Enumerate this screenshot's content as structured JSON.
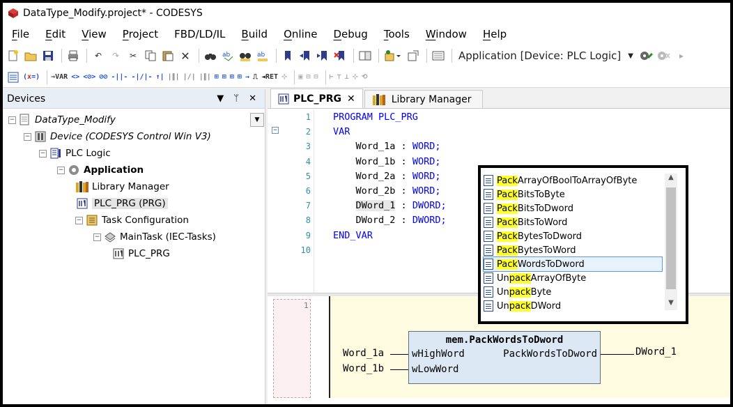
{
  "window": {
    "title": "DataType_Modify.project* - CODESYS"
  },
  "menu": [
    {
      "label": "File",
      "acc": "F",
      "rest": "ile"
    },
    {
      "label": "Edit",
      "acc": "E",
      "rest": "dit"
    },
    {
      "label": "View",
      "acc": "V",
      "rest": "iew"
    },
    {
      "label": "Project",
      "acc": "P",
      "rest": "roject"
    },
    {
      "label": "FBD/LD/IL",
      "acc": "",
      "rest": "FBD/LD/IL"
    },
    {
      "label": "Build",
      "acc": "B",
      "rest": "uild"
    },
    {
      "label": "Online",
      "acc": "O",
      "rest": "nline"
    },
    {
      "label": "Debug",
      "acc": "D",
      "rest": "ebug"
    },
    {
      "label": "Tools",
      "acc": "T",
      "rest": "ools"
    },
    {
      "label": "Window",
      "acc": "W",
      "rest": "indow"
    },
    {
      "label": "Help",
      "acc": "H",
      "rest": "elp"
    }
  ],
  "toolbar": {
    "application_combo": "Application [Device: PLC Logic]"
  },
  "devices": {
    "header": "Devices",
    "pin_glyph": "ᛘ",
    "close_glyph": "✕",
    "tree": [
      {
        "label": "DataType_Modify",
        "italic": true
      },
      {
        "label": "Device (CODESYS Control Win V3)",
        "italic": true
      },
      {
        "label": "PLC Logic"
      },
      {
        "label": "Application",
        "bold": true
      },
      {
        "label": "Library Manager"
      },
      {
        "label": "PLC_PRG (PRG)"
      },
      {
        "label": "Task Configuration"
      },
      {
        "label": "MainTask (IEC-Tasks)"
      },
      {
        "label": "PLC_PRG"
      }
    ]
  },
  "editor": {
    "tabs": [
      {
        "label": "PLC_PRG",
        "close": "✕"
      },
      {
        "label": "Library Manager"
      }
    ],
    "line_numbers": [
      "1",
      "2",
      "3",
      "4",
      "5",
      "6",
      "7",
      "8",
      "9",
      "10"
    ],
    "code": {
      "l1": "PROGRAM PLC_PRG",
      "l2": "VAR",
      "l3a": "Word_1a",
      "l3b": "WORD;",
      "l4a": "Word_1b",
      "l4b": "WORD;",
      "l5a": "Word_2a",
      "l5b": "WORD;",
      "l6a": "Word_2b",
      "l6b": "WORD;",
      "l7a": "DWord_1",
      "l7b": "DWORD;",
      "l8a": "DWord_2",
      "l8b": "DWORD;",
      "l9": "END_VAR",
      "colon": " : "
    }
  },
  "fbd": {
    "rung_number": "1",
    "block_title": "mem.PackWordsToDword",
    "input1_pin": "wHighWord",
    "input2_pin": "wLowWord",
    "output_pin": "PackWordsToDword",
    "input1_var": "Word_1a",
    "input2_var": "Word_1b",
    "output_var": "DWord_1"
  },
  "autocomplete": {
    "items": [
      {
        "pre": "",
        "mark": "Pack",
        "post": "ArrayOfBoolToArrayOfByte"
      },
      {
        "pre": "",
        "mark": "Pack",
        "post": "BitsToByte"
      },
      {
        "pre": "",
        "mark": "Pack",
        "post": "BitsToDword"
      },
      {
        "pre": "",
        "mark": "Pack",
        "post": "BitsToWord"
      },
      {
        "pre": "",
        "mark": "Pack",
        "post": "BytesToDword"
      },
      {
        "pre": "",
        "mark": "Pack",
        "post": "BytesToWord"
      },
      {
        "pre": "",
        "mark": "Pack",
        "post": "WordsToDword"
      },
      {
        "pre": "Un",
        "mark": "pack",
        "post": "ArrayOfByte"
      },
      {
        "pre": "Un",
        "mark": "pack",
        "post": "Byte"
      },
      {
        "pre": "Un",
        "mark": "pack",
        "post": "DWord"
      }
    ],
    "selected_index": 6
  }
}
